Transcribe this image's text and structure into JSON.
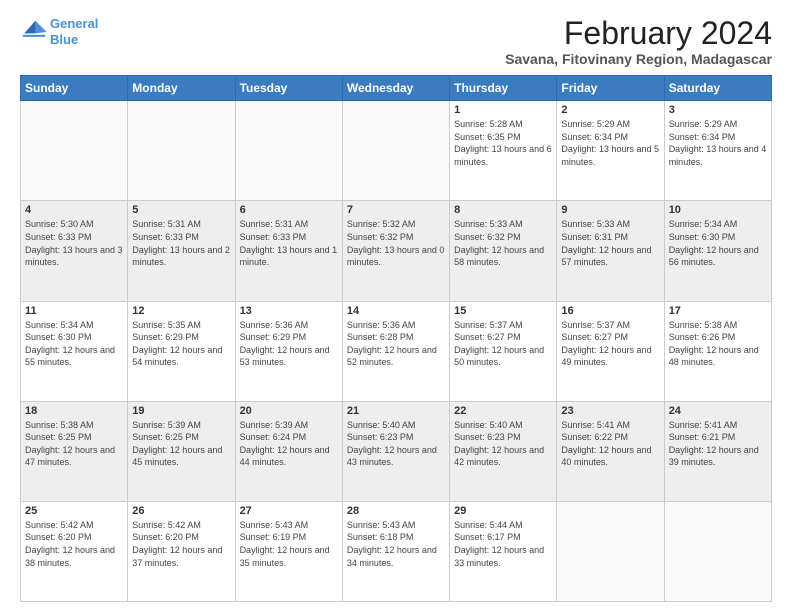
{
  "logo": {
    "line1": "General",
    "line2": "Blue"
  },
  "title": "February 2024",
  "subtitle": "Savana, Fitovinany Region, Madagascar",
  "days_of_week": [
    "Sunday",
    "Monday",
    "Tuesday",
    "Wednesday",
    "Thursday",
    "Friday",
    "Saturday"
  ],
  "weeks": [
    [
      {
        "day": "",
        "info": ""
      },
      {
        "day": "",
        "info": ""
      },
      {
        "day": "",
        "info": ""
      },
      {
        "day": "",
        "info": ""
      },
      {
        "day": "1",
        "info": "Sunrise: 5:28 AM\nSunset: 6:35 PM\nDaylight: 13 hours\nand 6 minutes."
      },
      {
        "day": "2",
        "info": "Sunrise: 5:29 AM\nSunset: 6:34 PM\nDaylight: 13 hours\nand 5 minutes."
      },
      {
        "day": "3",
        "info": "Sunrise: 5:29 AM\nSunset: 6:34 PM\nDaylight: 13 hours\nand 4 minutes."
      }
    ],
    [
      {
        "day": "4",
        "info": "Sunrise: 5:30 AM\nSunset: 6:33 PM\nDaylight: 13 hours\nand 3 minutes."
      },
      {
        "day": "5",
        "info": "Sunrise: 5:31 AM\nSunset: 6:33 PM\nDaylight: 13 hours\nand 2 minutes."
      },
      {
        "day": "6",
        "info": "Sunrise: 5:31 AM\nSunset: 6:33 PM\nDaylight: 13 hours\nand 1 minute."
      },
      {
        "day": "7",
        "info": "Sunrise: 5:32 AM\nSunset: 6:32 PM\nDaylight: 13 hours\nand 0 minutes."
      },
      {
        "day": "8",
        "info": "Sunrise: 5:33 AM\nSunset: 6:32 PM\nDaylight: 12 hours\nand 58 minutes."
      },
      {
        "day": "9",
        "info": "Sunrise: 5:33 AM\nSunset: 6:31 PM\nDaylight: 12 hours\nand 57 minutes."
      },
      {
        "day": "10",
        "info": "Sunrise: 5:34 AM\nSunset: 6:30 PM\nDaylight: 12 hours\nand 56 minutes."
      }
    ],
    [
      {
        "day": "11",
        "info": "Sunrise: 5:34 AM\nSunset: 6:30 PM\nDaylight: 12 hours\nand 55 minutes."
      },
      {
        "day": "12",
        "info": "Sunrise: 5:35 AM\nSunset: 6:29 PM\nDaylight: 12 hours\nand 54 minutes."
      },
      {
        "day": "13",
        "info": "Sunrise: 5:36 AM\nSunset: 6:29 PM\nDaylight: 12 hours\nand 53 minutes."
      },
      {
        "day": "14",
        "info": "Sunrise: 5:36 AM\nSunset: 6:28 PM\nDaylight: 12 hours\nand 52 minutes."
      },
      {
        "day": "15",
        "info": "Sunrise: 5:37 AM\nSunset: 6:27 PM\nDaylight: 12 hours\nand 50 minutes."
      },
      {
        "day": "16",
        "info": "Sunrise: 5:37 AM\nSunset: 6:27 PM\nDaylight: 12 hours\nand 49 minutes."
      },
      {
        "day": "17",
        "info": "Sunrise: 5:38 AM\nSunset: 6:26 PM\nDaylight: 12 hours\nand 48 minutes."
      }
    ],
    [
      {
        "day": "18",
        "info": "Sunrise: 5:38 AM\nSunset: 6:25 PM\nDaylight: 12 hours\nand 47 minutes."
      },
      {
        "day": "19",
        "info": "Sunrise: 5:39 AM\nSunset: 6:25 PM\nDaylight: 12 hours\nand 45 minutes."
      },
      {
        "day": "20",
        "info": "Sunrise: 5:39 AM\nSunset: 6:24 PM\nDaylight: 12 hours\nand 44 minutes."
      },
      {
        "day": "21",
        "info": "Sunrise: 5:40 AM\nSunset: 6:23 PM\nDaylight: 12 hours\nand 43 minutes."
      },
      {
        "day": "22",
        "info": "Sunrise: 5:40 AM\nSunset: 6:23 PM\nDaylight: 12 hours\nand 42 minutes."
      },
      {
        "day": "23",
        "info": "Sunrise: 5:41 AM\nSunset: 6:22 PM\nDaylight: 12 hours\nand 40 minutes."
      },
      {
        "day": "24",
        "info": "Sunrise: 5:41 AM\nSunset: 6:21 PM\nDaylight: 12 hours\nand 39 minutes."
      }
    ],
    [
      {
        "day": "25",
        "info": "Sunrise: 5:42 AM\nSunset: 6:20 PM\nDaylight: 12 hours\nand 38 minutes."
      },
      {
        "day": "26",
        "info": "Sunrise: 5:42 AM\nSunset: 6:20 PM\nDaylight: 12 hours\nand 37 minutes."
      },
      {
        "day": "27",
        "info": "Sunrise: 5:43 AM\nSunset: 6:19 PM\nDaylight: 12 hours\nand 35 minutes."
      },
      {
        "day": "28",
        "info": "Sunrise: 5:43 AM\nSunset: 6:18 PM\nDaylight: 12 hours\nand 34 minutes."
      },
      {
        "day": "29",
        "info": "Sunrise: 5:44 AM\nSunset: 6:17 PM\nDaylight: 12 hours\nand 33 minutes."
      },
      {
        "day": "",
        "info": ""
      },
      {
        "day": "",
        "info": ""
      }
    ]
  ]
}
